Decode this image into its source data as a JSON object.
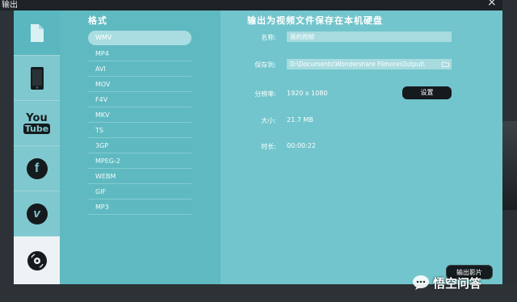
{
  "window": {
    "title": "输出"
  },
  "sidebar": {
    "items": [
      {
        "name": "device-file",
        "icon": "file-icon"
      },
      {
        "name": "device-phone",
        "icon": "phone-icon"
      },
      {
        "name": "youtube",
        "icon": "youtube-icon",
        "label_top": "You",
        "label_bottom": "Tube"
      },
      {
        "name": "facebook",
        "icon": "facebook-icon",
        "label": "f"
      },
      {
        "name": "vimeo",
        "icon": "vimeo-icon",
        "label": "v"
      },
      {
        "name": "dvd",
        "icon": "disc-icon"
      }
    ]
  },
  "formats": {
    "title": "格式",
    "items": [
      "WMV",
      "MP4",
      "AVI",
      "MOV",
      "F4V",
      "MKV",
      "TS",
      "3GP",
      "MPEG-2",
      "WEBM",
      "GIF",
      "MP3"
    ],
    "selected": "WMV"
  },
  "settings": {
    "title": "输出为视频文件保存在本机硬盘",
    "name_label": "名称:",
    "name_value": "我的视频",
    "saveto_label": "保存到:",
    "saveto_value": "D:\\Documents\\Wondershare Filmora\\Output\\",
    "resolution_label": "分辨率:",
    "resolution_value": "1920 x 1080",
    "settings_button": "设置",
    "size_label": "大小:",
    "size_value": "21.7 MB",
    "duration_label": "时长:",
    "duration_value": "00:00:22"
  },
  "footer": {
    "export_button": "输出影片"
  },
  "watermark": {
    "text": "悟空问答"
  },
  "colors": {
    "sidebar": "#7fc8cf",
    "format_panel": "#5fb9c1",
    "settings_panel": "#72c5cc",
    "button": "#141a1d"
  }
}
